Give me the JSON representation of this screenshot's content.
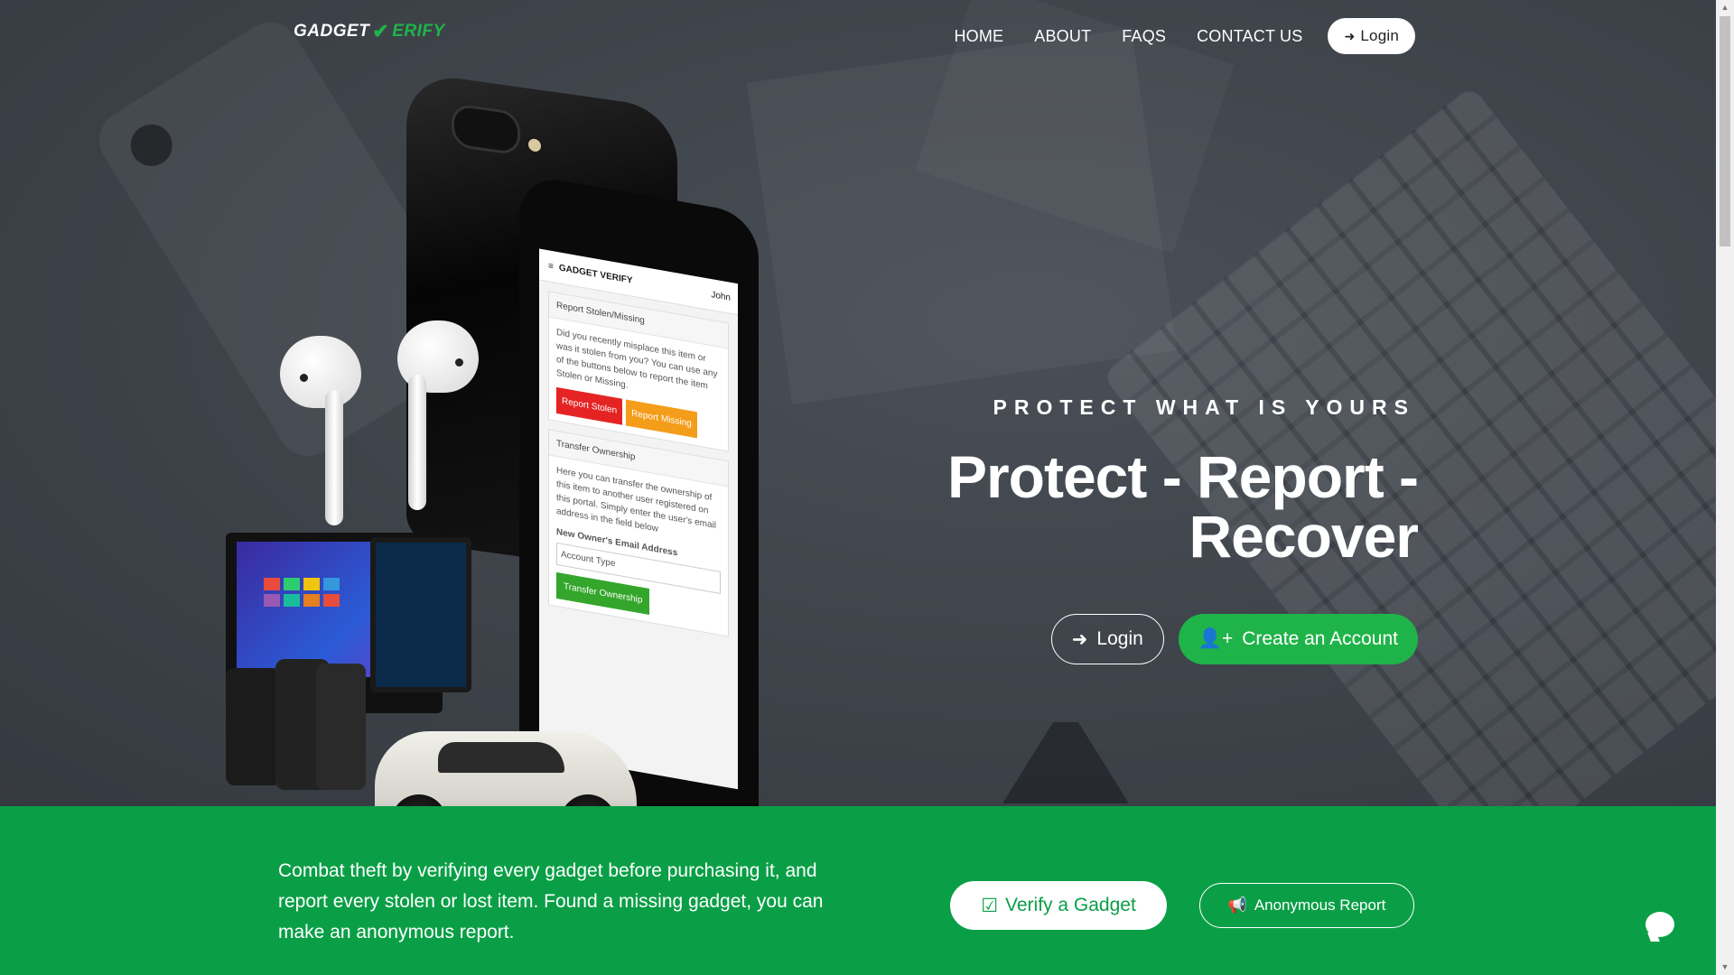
{
  "brand": {
    "logo_prefix": "GADGET",
    "logo_suffix": "ERIFY",
    "accent": "#1fb449",
    "band_color": "#0a9f46"
  },
  "nav": {
    "items": [
      "HOME",
      "ABOUT",
      "FAQS",
      "CONTACT US"
    ],
    "login_label": "Login"
  },
  "hero": {
    "tagline": "PROTECT WHAT IS YOURS",
    "headline": "Protect - Report - Recover",
    "login_label": "Login",
    "create_label": "Create an Account"
  },
  "mockup": {
    "app_name": "GADGET VERIFY",
    "user": "John",
    "card1_title": "Report Stolen/Missing",
    "card1_body": "Did you recently misplace this item or was it stolen from you? You can use any of the buttons below to report the item Stolen or Missing.",
    "btn_stolen": "Report Stolen",
    "btn_missing": "Report Missing",
    "card2_title": "Transfer Ownership",
    "card2_body": "Here you can transfer the ownership of this item to another user registered on this portal. Simply enter the user's email address in the field below",
    "field_label": "New Owner's Email Address",
    "select_label": "Account Type",
    "btn_transfer": "Transfer Ownership"
  },
  "band": {
    "text": "Combat theft by verifying every gadget before purchasing it, and report every stolen or lost item. Found a missing gadget, you can make an anonymous report.",
    "verify_label": "Verify a Gadget",
    "anon_label": "Anonymous Report"
  },
  "icons": {
    "login": "sign-in-icon",
    "create": "user-plus-icon",
    "verify": "check-square-icon",
    "anon": "bullhorn-icon",
    "chat": "chat-icon"
  }
}
